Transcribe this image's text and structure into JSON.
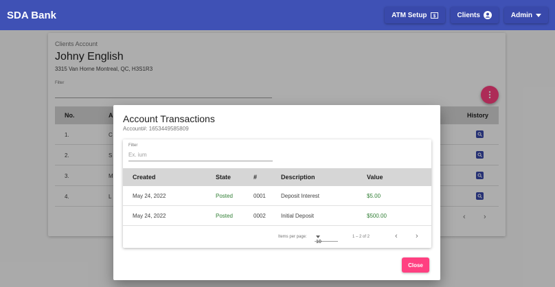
{
  "app": {
    "title": "SDA Bank"
  },
  "nav": {
    "atm_label": "ATM Setup",
    "clients_label": "Clients",
    "admin_label": "Admin"
  },
  "client": {
    "subtitle": "Clients Account",
    "name": "Johny English",
    "address": "3315 Van Horne Montreal, QC, H3S1R3",
    "filter_label": "Filter"
  },
  "accounts_table": {
    "headers": {
      "no": "No.",
      "account": "A",
      "history": "History"
    },
    "rows": [
      {
        "no": "1.",
        "account": "C"
      },
      {
        "no": "2.",
        "account": "S"
      },
      {
        "no": "3.",
        "account": "M"
      },
      {
        "no": "4.",
        "account": "L"
      }
    ],
    "prev": "‹",
    "next": "›"
  },
  "dialog": {
    "title": "Account Transactions",
    "account_number": "Account#: 1653449585809",
    "filter_label": "Filter",
    "filter_placeholder": "Ex. ium",
    "headers": {
      "created": "Created",
      "state": "State",
      "num": "#",
      "description": "Description",
      "value": "Value"
    },
    "rows": [
      {
        "created": "May 24, 2022",
        "state": "Posted",
        "num": "0001",
        "description": "Deposit Interest",
        "value": "$5.00"
      },
      {
        "created": "May 24, 2022",
        "state": "Posted",
        "num": "0002",
        "description": "Initial Deposit",
        "value": "$500.00"
      }
    ],
    "paginator": {
      "items_per_page_label": "Items per page:",
      "page_size": "10",
      "range": "1 – 2 of 2",
      "prev": "‹",
      "next": "›"
    },
    "close_label": "Close"
  },
  "colors": {
    "primary": "#3f51b5",
    "accent": "#ff4081",
    "posted": "#2e7d32"
  }
}
